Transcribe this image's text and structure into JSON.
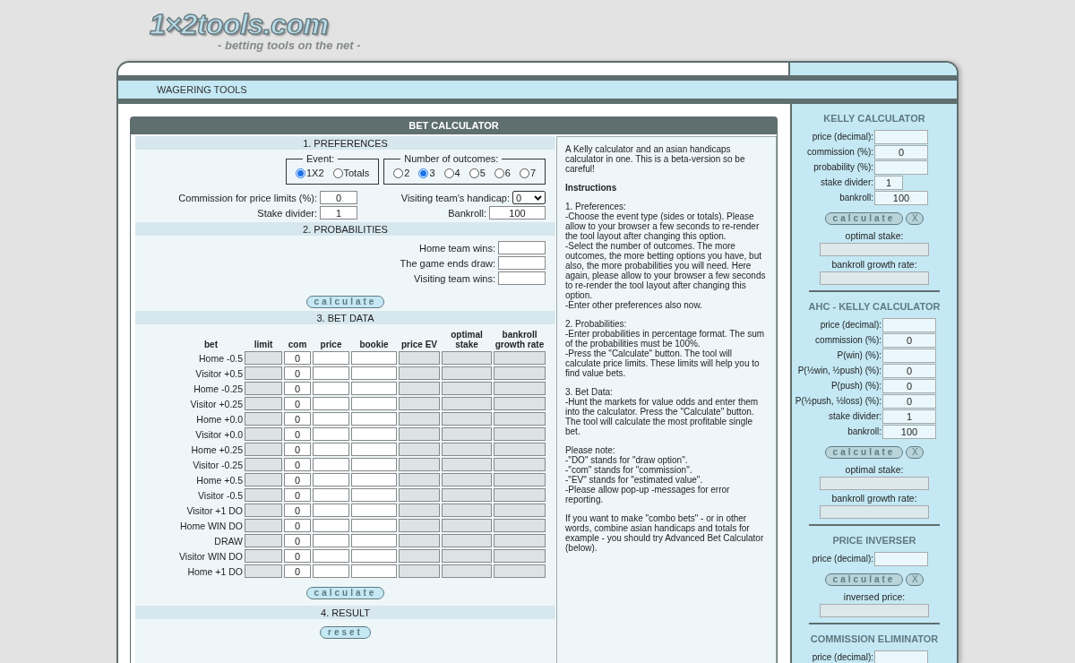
{
  "logo": {
    "name": "1×2tools.com",
    "tagline": "- betting tools on the net -"
  },
  "nav": {
    "label": "WAGERING TOOLS"
  },
  "calculator": {
    "title": "BET CALCULATOR",
    "preferences": {
      "heading": "1. PREFERENCES",
      "event": {
        "legend": "Event:",
        "options": [
          {
            "label": "1X2",
            "selected": true
          },
          {
            "label": "Totals",
            "selected": false
          }
        ]
      },
      "outcomes": {
        "legend": "Number of outcomes:",
        "options": [
          {
            "label": "2",
            "selected": false
          },
          {
            "label": "3",
            "selected": true
          },
          {
            "label": "4",
            "selected": false
          },
          {
            "label": "5",
            "selected": false
          },
          {
            "label": "6",
            "selected": false
          },
          {
            "label": "7",
            "selected": false
          }
        ]
      },
      "commission": {
        "label": "Commission for price limits (%):",
        "value": "0"
      },
      "handicap": {
        "label": "Visiting team's handicap:",
        "value": "0"
      },
      "stake_divider": {
        "label": "Stake divider:",
        "value": "1"
      },
      "bankroll": {
        "label": "Bankroll:",
        "value": "100"
      }
    },
    "probabilities": {
      "heading": "2. PROBABILITIES",
      "fields": [
        "Home team wins:",
        "The game ends draw:",
        "Visiting team wins:"
      ],
      "button": "calculate"
    },
    "bet_data": {
      "heading": "3. BET DATA",
      "columns": [
        "bet",
        "limit",
        "com",
        "price",
        "bookie",
        "price EV",
        "optimal stake",
        "bankroll growth rate"
      ],
      "rows": [
        {
          "bet": "Home -0.5",
          "com": "0"
        },
        {
          "bet": "Visitor +0.5",
          "com": "0"
        },
        {
          "bet": "Home -0.25",
          "com": "0"
        },
        {
          "bet": "Visitor +0.25",
          "com": "0"
        },
        {
          "bet": "Home +0.0",
          "com": "0"
        },
        {
          "bet": "Visitor +0.0",
          "com": "0"
        },
        {
          "bet": "Home +0.25",
          "com": "0"
        },
        {
          "bet": "Visitor -0.25",
          "com": "0"
        },
        {
          "bet": "Home +0.5",
          "com": "0"
        },
        {
          "bet": "Visitor -0.5",
          "com": "0"
        },
        {
          "bet": "Visitor +1 DO",
          "com": "0"
        },
        {
          "bet": "Home WIN DO",
          "com": "0"
        },
        {
          "bet": "DRAW",
          "com": "0"
        },
        {
          "bet": "Visitor WIN DO",
          "com": "0"
        },
        {
          "bet": "Home +1 DO",
          "com": "0"
        }
      ],
      "button": "calculate"
    },
    "result": {
      "heading": "4. RESULT",
      "button": "reset"
    },
    "info": {
      "paragraphs": [
        {
          "kind": "text",
          "text": "A Kelly calculator and an asian handicaps calculator in one. This is a beta-version so be careful!"
        },
        {
          "kind": "heading",
          "text": "Instructions"
        },
        {
          "kind": "text",
          "text": "1. Preferences:\n-Choose the event type (sides or totals). Please allow to your browser a few seconds to re-render the tool layout after changing this option.\n-Select the number of outcomes. The more outcomes, the more betting options you have, but also, the more probabilities you will need. Here again, please allow to your browser a few seconds to re-render the tool layout after changing this option.\n-Enter other preferences also now."
        },
        {
          "kind": "text",
          "text": "2. Probabilities:\n-Enter probabilities in percentage format. The sum of the probabilities must be 100%.\n-Press the \"Calculate\" button. The tool will calculate price limits. These limits will help you to find value bets."
        },
        {
          "kind": "text",
          "text": "3. Bet Data:\n-Hunt the markets for value odds and enter them into the calculator. Press the \"Calculate\" button. The tool will calculate the most profitable single bet."
        },
        {
          "kind": "text",
          "text": "Please note:\n-\"DO\" stands for \"draw option\".\n-\"com\" stands for \"commission\".\n-\"EV\" stands for \"estimated value\".\n-Please allow pop-up -messages for error reporting."
        },
        {
          "kind": "text",
          "text": "If you want to make \"combo bets\" - or in other words, combine asian handicaps and totals for example - you should try Advanced Bet Calculator (below)."
        }
      ]
    }
  },
  "sidebar": [
    {
      "title": "KELLY CALCULATOR",
      "fields": [
        {
          "label": "price (decimal):",
          "kind": "wide"
        },
        {
          "label": "commission (%):",
          "value": "0",
          "kind": "wide"
        },
        {
          "label": "probability (%):",
          "kind": "wide"
        },
        {
          "label": "stake divider:",
          "value": "1",
          "kind": "short"
        },
        {
          "label": "bankroll:",
          "value": "100",
          "kind": "wide"
        }
      ],
      "button": "calculate",
      "clear": "X",
      "outputs": [
        "optimal stake:",
        "bankroll growth rate:"
      ]
    },
    {
      "title": "AHC - KELLY CALCULATOR",
      "fields": [
        {
          "label": "price (decimal):",
          "kind": "wide"
        },
        {
          "label": "commission (%):",
          "value": "0",
          "kind": "wide"
        },
        {
          "label": "P(win) (%):",
          "kind": "wide"
        },
        {
          "label": "P(½win, ½push) (%):",
          "value": "0",
          "kind": "wide"
        },
        {
          "label": "P(push) (%):",
          "value": "0",
          "kind": "wide"
        },
        {
          "label": "P(½push, ½loss) (%):",
          "value": "0",
          "kind": "wide"
        },
        {
          "label": "stake divider:",
          "value": "1",
          "kind": "wide"
        },
        {
          "label": "bankroll:",
          "value": "100",
          "kind": "wide"
        }
      ],
      "button": "calculate",
      "clear": "X",
      "outputs": [
        "optimal stake:",
        "bankroll growth rate:"
      ]
    },
    {
      "title": "PRICE INVERSER",
      "fields": [
        {
          "label": "price (decimal):",
          "kind": "wide"
        }
      ],
      "button": "calculate",
      "clear": "X",
      "outputs": [
        "inversed price:"
      ]
    },
    {
      "title": "COMMISSION ELIMINATOR",
      "fields": [
        {
          "label": "price (decimal):",
          "kind": "wide"
        }
      ]
    }
  ]
}
